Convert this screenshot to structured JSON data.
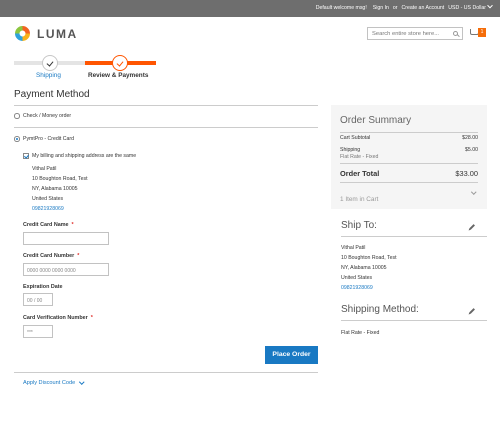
{
  "topbar": {
    "welcome": "Default welcome msg!",
    "sign_in": "Sign In",
    "or": "or",
    "create_account": "Create an Account",
    "currency": "USD - US Dollar"
  },
  "header": {
    "logo_text": "LUMA",
    "search_placeholder": "Search entire store here...",
    "cart_count": "1"
  },
  "progress": {
    "steps": [
      {
        "label": "Shipping",
        "state": "completed"
      },
      {
        "label": "Review & Payments",
        "state": "current"
      }
    ]
  },
  "payment": {
    "heading": "Payment Method",
    "methods": [
      {
        "label": "Check / Money order",
        "selected": false
      },
      {
        "label": "PymtPro - Credit Card",
        "selected": true
      }
    ],
    "same_address_label": "My billing and shipping address are the same",
    "address": {
      "name": "Vithal Patil",
      "street": "10 Boughton Road, Test",
      "city": "NY, Alabama 10005",
      "country": "United States",
      "phone": "09821928069"
    },
    "fields": {
      "cc_name": {
        "label": "Credit Card Name",
        "value": "",
        "placeholder": ""
      },
      "cc_number": {
        "label": "Credit Card Number",
        "placeholder": "0000 0000 0000 0000"
      },
      "expiration": {
        "label": "Expiration Date",
        "placeholder": "00 / 00"
      },
      "cvv": {
        "label": "Card Verification Number",
        "placeholder": "***"
      }
    },
    "place_order": "Place Order",
    "discount_link": "Apply Discount Code"
  },
  "summary": {
    "title": "Order Summary",
    "cart_subtotal_label": "Cart Subtotal",
    "cart_subtotal_value": "$28.00",
    "shipping_label": "Shipping",
    "shipping_value": "$5.00",
    "shipping_method": "Flat Rate - Fixed",
    "order_total_label": "Order Total",
    "order_total_value": "$33.00",
    "items_in_cart": "1 Item in Cart"
  },
  "ship_to": {
    "heading": "Ship To:",
    "name": "Vithal Patil",
    "street": "10 Boughton Road, Test",
    "city": "NY, Alabama 10005",
    "country": "United States",
    "phone": "09821928069"
  },
  "shipping_method": {
    "heading": "Shipping Method:",
    "value": "Flat Rate - Fixed"
  },
  "colors": {
    "accent": "#1979c3",
    "brand_orange": "#ff5501",
    "topbar": "#6e6e6e",
    "summary_bg": "#f5f5f5"
  },
  "icons": [
    "luma-logo-icon",
    "search-icon",
    "cart-icon",
    "check-icon",
    "pencil-icon",
    "chevron-down-icon"
  ]
}
